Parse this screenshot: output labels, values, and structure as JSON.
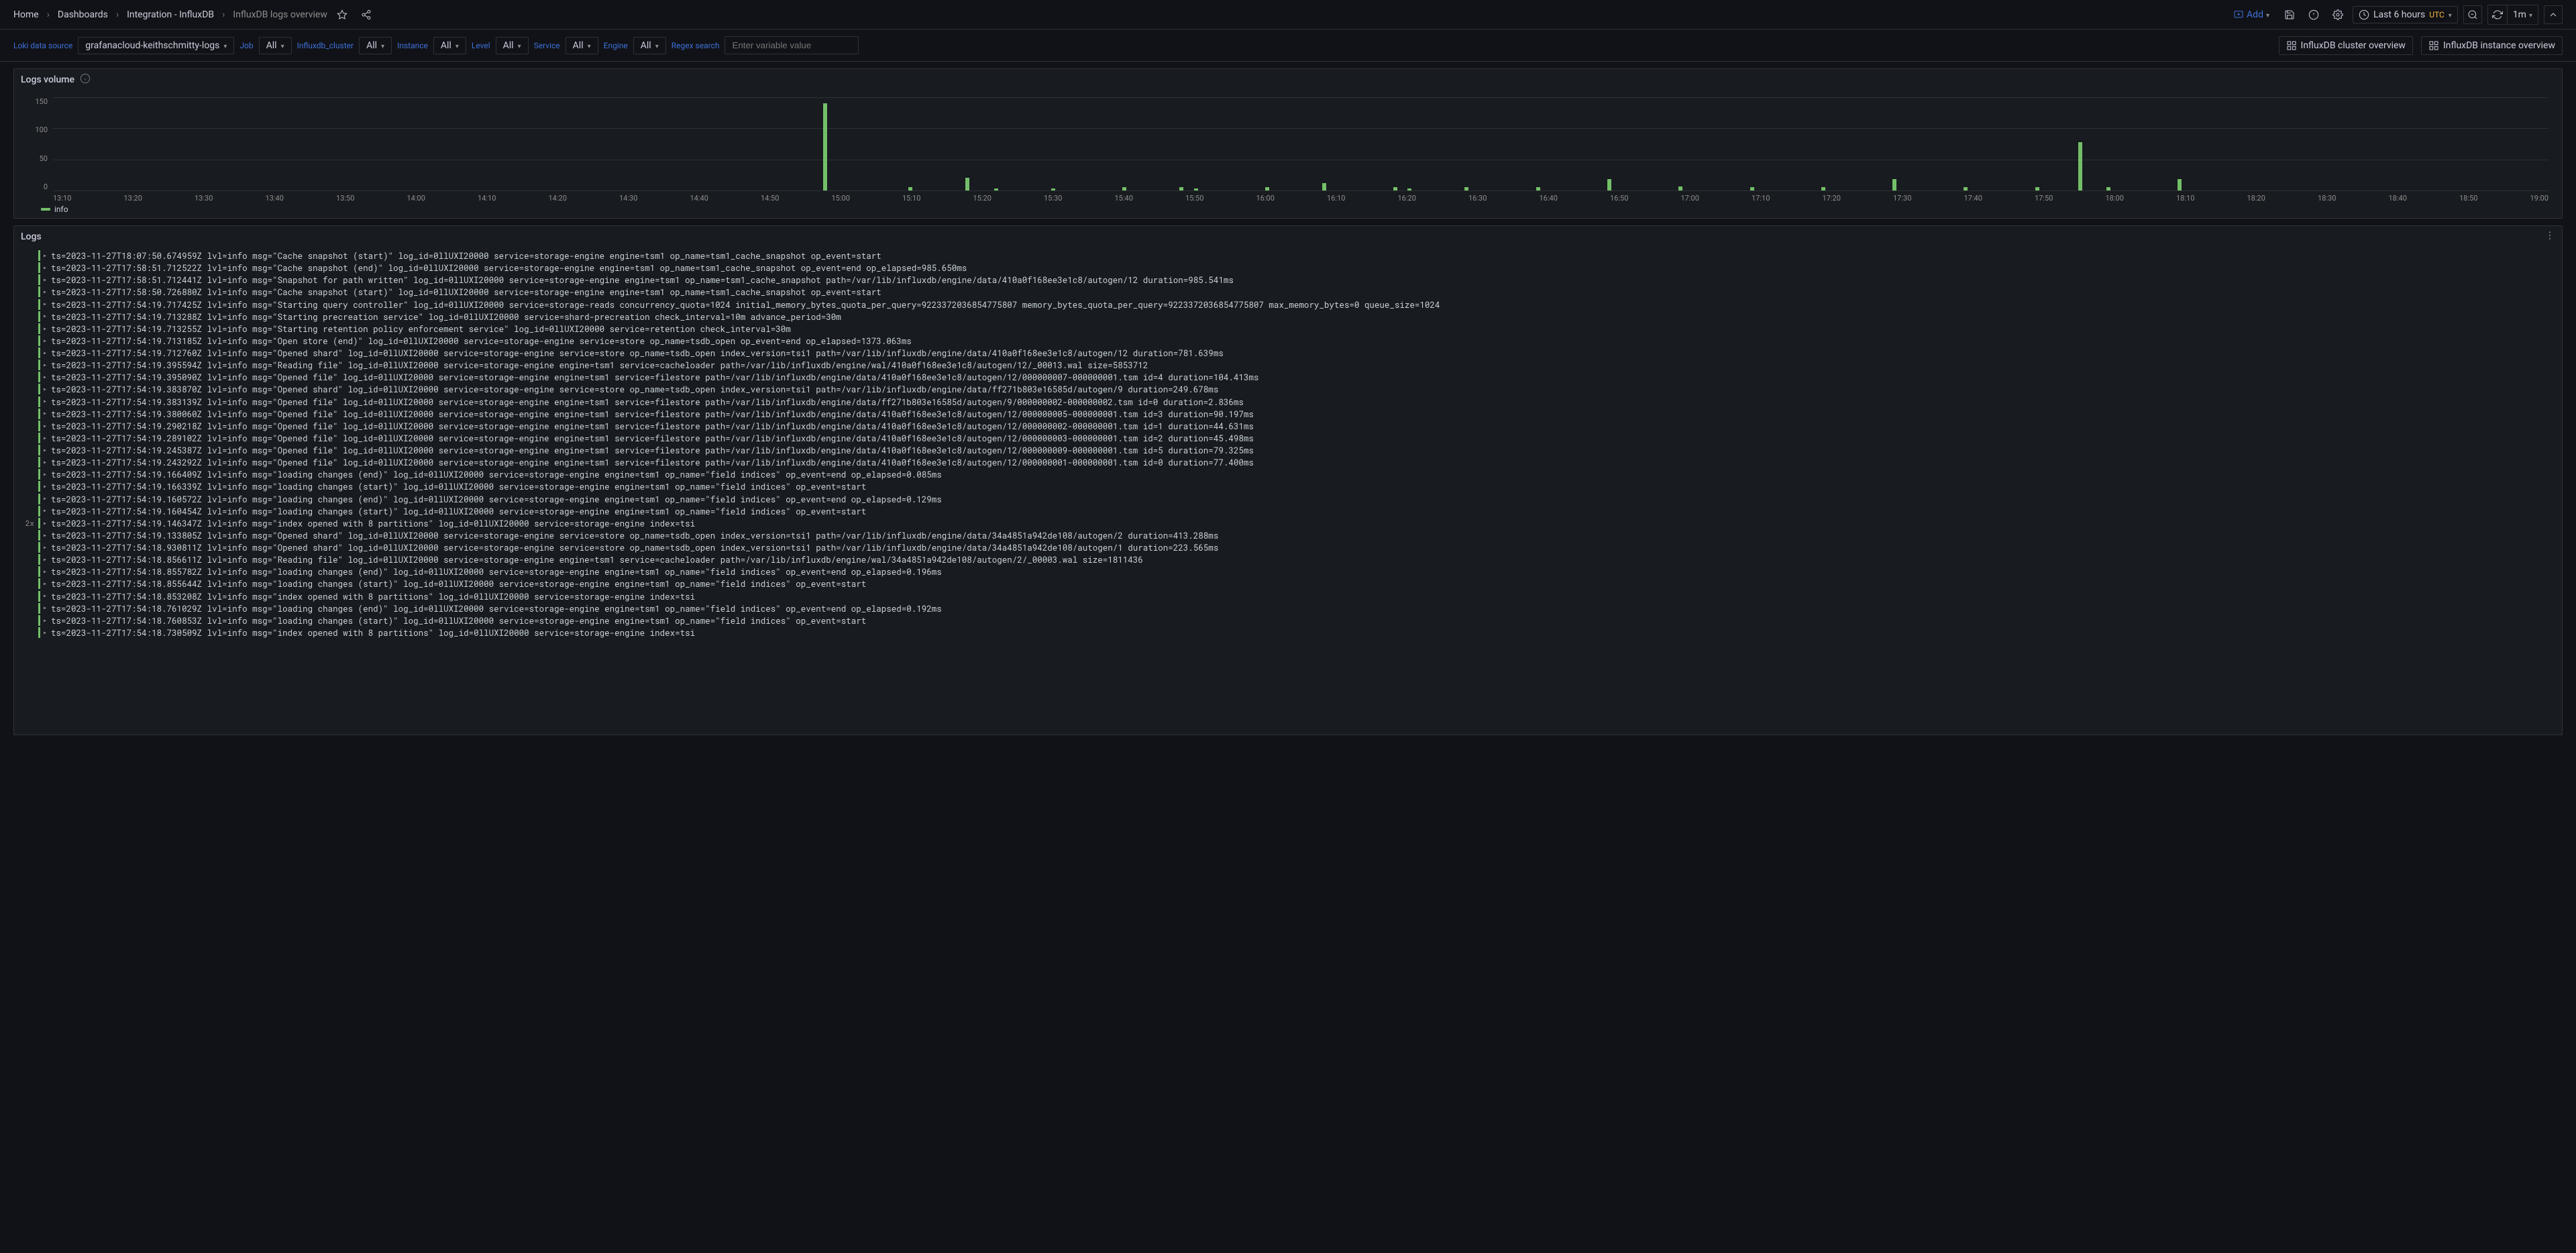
{
  "breadcrumbs": {
    "home": "Home",
    "dashboards": "Dashboards",
    "folder": "Integration - InfluxDB",
    "current": "InfluxDB logs overview"
  },
  "header": {
    "add": "Add",
    "time_range": "Last 6 hours",
    "tz": "UTC",
    "refresh_interval": "1m"
  },
  "variables": {
    "data_source_label": "Loki data source",
    "data_source_value": "grafanacloud-keithschmitty-logs",
    "job_label": "Job",
    "job_value": "All",
    "cluster_label": "Influxdb_cluster",
    "cluster_value": "All",
    "instance_label": "Instance",
    "instance_value": "All",
    "level_label": "Level",
    "level_value": "All",
    "service_label": "Service",
    "service_value": "All",
    "engine_label": "Engine",
    "engine_value": "All",
    "regex_label": "Regex search",
    "regex_placeholder": "Enter variable value",
    "link_cluster": "InfluxDB cluster overview",
    "link_instance": "InfluxDB instance overview"
  },
  "chart_data": {
    "type": "bar",
    "title": "Logs volume",
    "ylabel": "",
    "xlabel": "",
    "ylim": [
      0,
      150
    ],
    "y_ticks": [
      "150",
      "100",
      "50",
      "0"
    ],
    "x_ticks": [
      "13:10",
      "13:20",
      "13:30",
      "13:40",
      "13:50",
      "14:00",
      "14:10",
      "14:20",
      "14:30",
      "14:40",
      "14:50",
      "15:00",
      "15:10",
      "15:20",
      "15:30",
      "15:40",
      "15:50",
      "16:00",
      "16:10",
      "16:20",
      "16:30",
      "16:40",
      "16:50",
      "17:00",
      "17:10",
      "17:20",
      "17:30",
      "17:40",
      "17:50",
      "18:00",
      "18:10",
      "18:20",
      "18:30",
      "18:40",
      "18:50",
      "19:00"
    ],
    "series": [
      {
        "name": "info",
        "color": "#73bf69",
        "values": [
          {
            "x": "14:58",
            "y": 140
          },
          {
            "x": "15:10",
            "y": 5
          },
          {
            "x": "15:18",
            "y": 20
          },
          {
            "x": "15:22",
            "y": 3
          },
          {
            "x": "15:30",
            "y": 3
          },
          {
            "x": "15:40",
            "y": 5
          },
          {
            "x": "15:48",
            "y": 5
          },
          {
            "x": "15:50",
            "y": 3
          },
          {
            "x": "16:00",
            "y": 5
          },
          {
            "x": "16:08",
            "y": 12
          },
          {
            "x": "16:18",
            "y": 5
          },
          {
            "x": "16:20",
            "y": 3
          },
          {
            "x": "16:28",
            "y": 5
          },
          {
            "x": "16:38",
            "y": 5
          },
          {
            "x": "16:48",
            "y": 18
          },
          {
            "x": "16:58",
            "y": 6
          },
          {
            "x": "17:08",
            "y": 5
          },
          {
            "x": "17:18",
            "y": 5
          },
          {
            "x": "17:28",
            "y": 18
          },
          {
            "x": "17:38",
            "y": 5
          },
          {
            "x": "17:48",
            "y": 5
          },
          {
            "x": "17:54",
            "y": 78
          },
          {
            "x": "17:58",
            "y": 5
          },
          {
            "x": "18:08",
            "y": 18
          }
        ]
      }
    ]
  },
  "logs_panel_title": "Logs",
  "log_lines": [
    {
      "count": "",
      "text": "ts=2023-11-27T18:07:50.674959Z lvl=info msg=\"Cache snapshot (start)\" log_id=0llUXI20000 service=storage-engine engine=tsm1 op_name=tsm1_cache_snapshot op_event=start"
    },
    {
      "count": "",
      "text": "ts=2023-11-27T17:58:51.712522Z lvl=info msg=\"Cache snapshot (end)\" log_id=0llUXI20000 service=storage-engine engine=tsm1 op_name=tsm1_cache_snapshot op_event=end op_elapsed=985.650ms"
    },
    {
      "count": "",
      "text": "ts=2023-11-27T17:58:51.712441Z lvl=info msg=\"Snapshot for path written\" log_id=0llUXI20000 service=storage-engine engine=tsm1 op_name=tsm1_cache_snapshot path=/var/lib/influxdb/engine/data/410a0f168ee3e1c8/autogen/12 duration=985.541ms"
    },
    {
      "count": "",
      "text": "ts=2023-11-27T17:58:50.726880Z lvl=info msg=\"Cache snapshot (start)\" log_id=0llUXI20000 service=storage-engine engine=tsm1 op_name=tsm1_cache_snapshot op_event=start"
    },
    {
      "count": "",
      "text": "ts=2023-11-27T17:54:19.717425Z lvl=info msg=\"Starting query controller\" log_id=0llUXI20000 service=storage-reads concurrency_quota=1024 initial_memory_bytes_quota_per_query=9223372036854775807 memory_bytes_quota_per_query=9223372036854775807 max_memory_bytes=0 queue_size=1024"
    },
    {
      "count": "",
      "text": "ts=2023-11-27T17:54:19.713288Z lvl=info msg=\"Starting precreation service\" log_id=0llUXI20000 service=shard-precreation check_interval=10m advance_period=30m"
    },
    {
      "count": "",
      "text": "ts=2023-11-27T17:54:19.713255Z lvl=info msg=\"Starting retention policy enforcement service\" log_id=0llUXI20000 service=retention check_interval=30m"
    },
    {
      "count": "",
      "text": "ts=2023-11-27T17:54:19.713185Z lvl=info msg=\"Open store (end)\" log_id=0llUXI20000 service=storage-engine service=store op_name=tsdb_open op_event=end op_elapsed=1373.063ms"
    },
    {
      "count": "",
      "text": "ts=2023-11-27T17:54:19.712760Z lvl=info msg=\"Opened shard\" log_id=0llUXI20000 service=storage-engine service=store op_name=tsdb_open index_version=tsi1 path=/var/lib/influxdb/engine/data/410a0f168ee3e1c8/autogen/12 duration=781.639ms"
    },
    {
      "count": "",
      "text": "ts=2023-11-27T17:54:19.395594Z lvl=info msg=\"Reading file\" log_id=0llUXI20000 service=storage-engine engine=tsm1 service=cacheloader path=/var/lib/influxdb/engine/wal/410a0f168ee3e1c8/autogen/12/_00013.wal size=5853712"
    },
    {
      "count": "",
      "text": "ts=2023-11-27T17:54:19.395090Z lvl=info msg=\"Opened file\" log_id=0llUXI20000 service=storage-engine engine=tsm1 service=filestore path=/var/lib/influxdb/engine/data/410a0f168ee3e1c8/autogen/12/000000007-000000001.tsm id=4 duration=104.413ms"
    },
    {
      "count": "",
      "text": "ts=2023-11-27T17:54:19.383870Z lvl=info msg=\"Opened shard\" log_id=0llUXI20000 service=storage-engine service=store op_name=tsdb_open index_version=tsi1 path=/var/lib/influxdb/engine/data/ff271b803e16585d/autogen/9 duration=249.678ms"
    },
    {
      "count": "",
      "text": "ts=2023-11-27T17:54:19.383139Z lvl=info msg=\"Opened file\" log_id=0llUXI20000 service=storage-engine engine=tsm1 service=filestore path=/var/lib/influxdb/engine/data/ff271b803e16585d/autogen/9/000000002-000000002.tsm id=0 duration=2.836ms"
    },
    {
      "count": "",
      "text": "ts=2023-11-27T17:54:19.380060Z lvl=info msg=\"Opened file\" log_id=0llUXI20000 service=storage-engine engine=tsm1 service=filestore path=/var/lib/influxdb/engine/data/410a0f168ee3e1c8/autogen/12/000000005-000000001.tsm id=3 duration=90.197ms"
    },
    {
      "count": "",
      "text": "ts=2023-11-27T17:54:19.290218Z lvl=info msg=\"Opened file\" log_id=0llUXI20000 service=storage-engine engine=tsm1 service=filestore path=/var/lib/influxdb/engine/data/410a0f168ee3e1c8/autogen/12/000000002-000000001.tsm id=1 duration=44.631ms"
    },
    {
      "count": "",
      "text": "ts=2023-11-27T17:54:19.289102Z lvl=info msg=\"Opened file\" log_id=0llUXI20000 service=storage-engine engine=tsm1 service=filestore path=/var/lib/influxdb/engine/data/410a0f168ee3e1c8/autogen/12/000000003-000000001.tsm id=2 duration=45.498ms"
    },
    {
      "count": "",
      "text": "ts=2023-11-27T17:54:19.245387Z lvl=info msg=\"Opened file\" log_id=0llUXI20000 service=storage-engine engine=tsm1 service=filestore path=/var/lib/influxdb/engine/data/410a0f168ee3e1c8/autogen/12/000000009-000000001.tsm id=5 duration=79.325ms"
    },
    {
      "count": "",
      "text": "ts=2023-11-27T17:54:19.243292Z lvl=info msg=\"Opened file\" log_id=0llUXI20000 service=storage-engine engine=tsm1 service=filestore path=/var/lib/influxdb/engine/data/410a0f168ee3e1c8/autogen/12/000000001-000000001.tsm id=0 duration=77.400ms"
    },
    {
      "count": "",
      "text": "ts=2023-11-27T17:54:19.166409Z lvl=info msg=\"loading changes (end)\" log_id=0llUXI20000 service=storage-engine engine=tsm1 op_name=\"field indices\" op_event=end op_elapsed=0.085ms"
    },
    {
      "count": "",
      "text": "ts=2023-11-27T17:54:19.166339Z lvl=info msg=\"loading changes (start)\" log_id=0llUXI20000 service=storage-engine engine=tsm1 op_name=\"field indices\" op_event=start"
    },
    {
      "count": "",
      "text": "ts=2023-11-27T17:54:19.160572Z lvl=info msg=\"loading changes (end)\" log_id=0llUXI20000 service=storage-engine engine=tsm1 op_name=\"field indices\" op_event=end op_elapsed=0.129ms"
    },
    {
      "count": "",
      "text": "ts=2023-11-27T17:54:19.160454Z lvl=info msg=\"loading changes (start)\" log_id=0llUXI20000 service=storage-engine engine=tsm1 op_name=\"field indices\" op_event=start"
    },
    {
      "count": "2x",
      "text": "ts=2023-11-27T17:54:19.146347Z lvl=info msg=\"index opened with 8 partitions\" log_id=0llUXI20000 service=storage-engine index=tsi"
    },
    {
      "count": "",
      "text": "ts=2023-11-27T17:54:19.133805Z lvl=info msg=\"Opened shard\" log_id=0llUXI20000 service=storage-engine service=store op_name=tsdb_open index_version=tsi1 path=/var/lib/influxdb/engine/data/34a4851a942de108/autogen/2 duration=413.288ms"
    },
    {
      "count": "",
      "text": "ts=2023-11-27T17:54:18.930811Z lvl=info msg=\"Opened shard\" log_id=0llUXI20000 service=storage-engine service=store op_name=tsdb_open index_version=tsi1 path=/var/lib/influxdb/engine/data/34a4851a942de108/autogen/1 duration=223.565ms"
    },
    {
      "count": "",
      "text": "ts=2023-11-27T17:54:18.856611Z lvl=info msg=\"Reading file\" log_id=0llUXI20000 service=storage-engine engine=tsm1 service=cacheloader path=/var/lib/influxdb/engine/wal/34a4851a942de108/autogen/2/_00003.wal size=1811436"
    },
    {
      "count": "",
      "text": "ts=2023-11-27T17:54:18.855782Z lvl=info msg=\"loading changes (end)\" log_id=0llUXI20000 service=storage-engine engine=tsm1 op_name=\"field indices\" op_event=end op_elapsed=0.196ms"
    },
    {
      "count": "",
      "text": "ts=2023-11-27T17:54:18.855644Z lvl=info msg=\"loading changes (start)\" log_id=0llUXI20000 service=storage-engine engine=tsm1 op_name=\"field indices\" op_event=start"
    },
    {
      "count": "",
      "text": "ts=2023-11-27T17:54:18.853208Z lvl=info msg=\"index opened with 8 partitions\" log_id=0llUXI20000 service=storage-engine index=tsi"
    },
    {
      "count": "",
      "text": "ts=2023-11-27T17:54:18.761029Z lvl=info msg=\"loading changes (end)\" log_id=0llUXI20000 service=storage-engine engine=tsm1 op_name=\"field indices\" op_event=end op_elapsed=0.192ms"
    },
    {
      "count": "",
      "text": "ts=2023-11-27T17:54:18.760853Z lvl=info msg=\"loading changes (start)\" log_id=0llUXI20000 service=storage-engine engine=tsm1 op_name=\"field indices\" op_event=start"
    },
    {
      "count": "",
      "text": "ts=2023-11-27T17:54:18.730509Z lvl=info msg=\"index opened with 8 partitions\" log_id=0llUXI20000 service=storage-engine index=tsi"
    }
  ]
}
